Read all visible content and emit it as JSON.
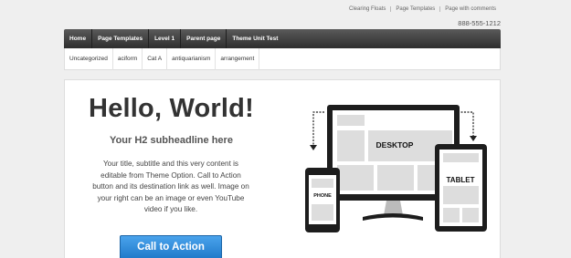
{
  "top_links": [
    "Clearing Floats",
    "Page Templates",
    "Page with comments"
  ],
  "phone": "888-555-1212",
  "main_nav": [
    "Home",
    "Page Templates",
    "Level 1",
    "Parent page",
    "Theme Unit Test"
  ],
  "sub_nav": [
    "Uncategorized",
    "aciform",
    "Cat A",
    "antiquarianism",
    "arrangement"
  ],
  "hero": {
    "title": "Hello, World!",
    "subtitle": "Your H2 subheadline here",
    "text": "Your title, subtitle and this very content is editable from Theme Option. Call to Action button and its destination link as well. Image on your right can be an image or even YouTube video if you like.",
    "cta_label": "Call to Action"
  },
  "devices": {
    "desktop_label": "DESKTOP",
    "tablet_label": "TABLET",
    "phone_label": "PHONE"
  }
}
